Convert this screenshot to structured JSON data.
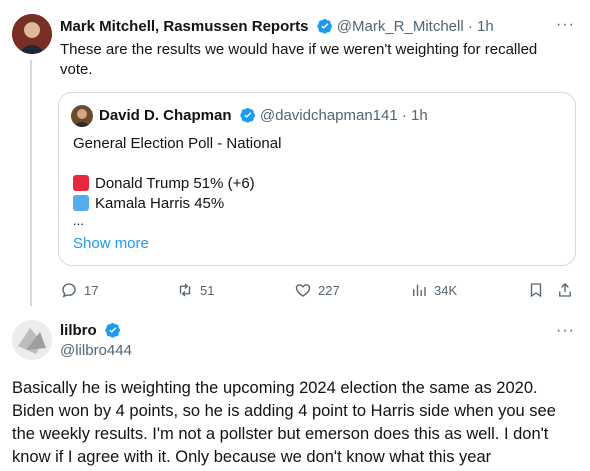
{
  "tweet1": {
    "name": "Mark Mitchell, Rasmussen Reports",
    "handle": "@Mark_R_Mitchell",
    "time": "· 1h",
    "text": "These are the results we would have if we weren't weighting for recalled vote.",
    "quote": {
      "name": "David D. Chapman",
      "handle": "@davidchapman141",
      "time": "· 1h",
      "title": "General Election Poll - National",
      "line1": "Donald Trump 51% (+6)",
      "line2": "Kamala Harris 45%",
      "ellipsis": "...",
      "show_more": "Show more",
      "colors": {
        "trump": "#e8283f",
        "harris": "#55acee"
      }
    },
    "actions": {
      "replies": "17",
      "retweets": "51",
      "likes": "227",
      "views": "34K"
    }
  },
  "tweet2": {
    "name": "lilbro",
    "handle": "@lilbro444",
    "text": "Basically he is weighting the upcoming 2024 election the same as 2020. Biden won by 4 points, so he is adding 4 point to Harris side when you see the weekly results. I'm not a pollster but emerson does this as well. I don't know if I agree with it. Only because we don't know what this year"
  },
  "colors": {
    "verified": "#1d9bf0",
    "link": "#1d9bf0",
    "text": "#0f1419",
    "muted": "#536471"
  }
}
